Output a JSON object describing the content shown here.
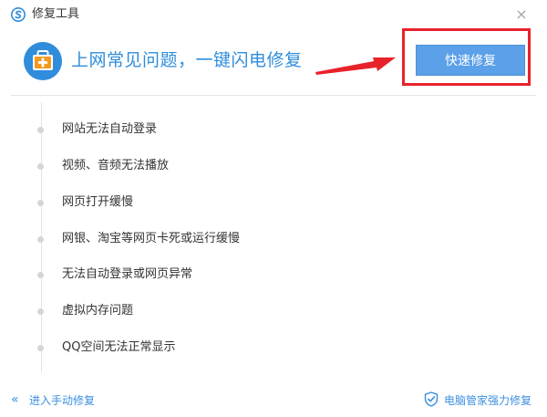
{
  "window": {
    "title": "修复工具",
    "close_glyph": "×"
  },
  "header": {
    "headline": "上网常见问题，一键闪电修复",
    "fix_button_label": "快速修复"
  },
  "issues": [
    {
      "label": "网站无法自动登录"
    },
    {
      "label": "视频、音频无法播放"
    },
    {
      "label": "网页打开缓慢"
    },
    {
      "label": "网银、淘宝等网页卡死或运行缓慢"
    },
    {
      "label": "无法自动登录或网页异常"
    },
    {
      "label": "虚拟内存问题"
    },
    {
      "label": "QQ空间无法正常显示"
    }
  ],
  "footer": {
    "manual_repair_label": "进入手动修复",
    "manual_repair_glyph": "«",
    "pc_manager_label": "电脑管家强力修复"
  },
  "colors": {
    "accent": "#2f8ddb",
    "button": "#5ba0e8",
    "highlight": "#e8222a",
    "kit_orange": "#f39a1f",
    "link": "#3c8fe0"
  },
  "icons": [
    "app-logo-icon",
    "close-icon",
    "first-aid-kit-icon",
    "red-arrow",
    "chevron-double-left-icon",
    "shield-check-icon"
  ]
}
